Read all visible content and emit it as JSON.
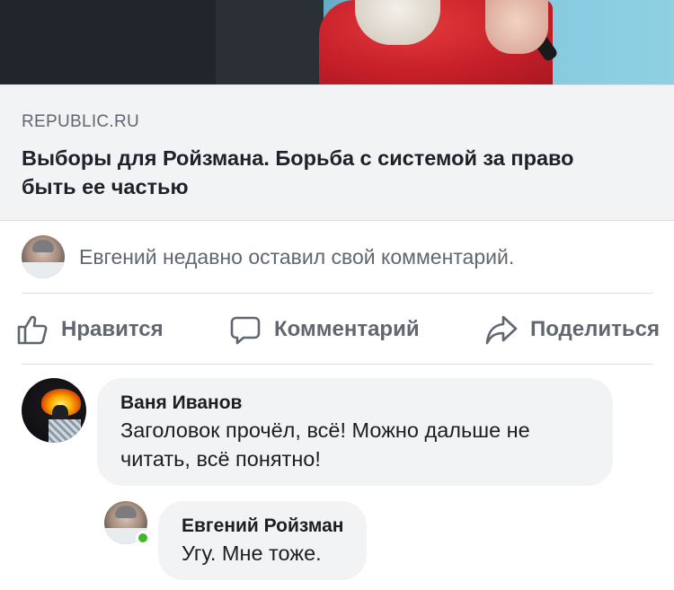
{
  "link_preview": {
    "domain": "REPUBLIC.RU",
    "title": "Выборы для Ройзмана. Борьба с системой за право быть ее частью"
  },
  "activity": {
    "text": "Евгений недавно оставил свой комментарий."
  },
  "actions": {
    "like_label": "Нравится",
    "comment_label": "Комментарий",
    "share_label": "Поделиться"
  },
  "comments": [
    {
      "author": "Ваня Иванов",
      "text": "Заголовок прочёл, всё! Можно дальше не читать, всё понятно!"
    },
    {
      "author": "Евгений Ройзман",
      "text": "Угу. Мне тоже.",
      "online": true
    }
  ],
  "colors": {
    "online": "#42b72a",
    "muted_text": "#606770",
    "bubble": "#f2f3f5"
  }
}
